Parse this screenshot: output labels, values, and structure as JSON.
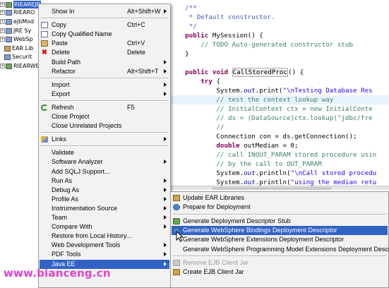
{
  "tree": {
    "items": [
      {
        "label": "RIEAREJB",
        "selected": true,
        "expander": "+"
      },
      {
        "label": "RIEARO",
        "expander": "+"
      },
      {
        "label": "ejbMod",
        "expander": "+"
      },
      {
        "label": "JRE Sy",
        "expander": "+"
      },
      {
        "label": "WebSp",
        "expander": "+"
      },
      {
        "label": "EAR Lib",
        "expander": ""
      },
      {
        "label": "Securit",
        "expander": ""
      },
      {
        "label": "RIEARWEB",
        "expander": "+"
      }
    ]
  },
  "editor": {
    "lines": [
      [
        {
          "t": "    /**",
          "c": "doc"
        }
      ],
      [
        {
          "t": "     * Default constructor.",
          "c": "doc"
        }
      ],
      [
        {
          "t": "     */",
          "c": "doc"
        }
      ],
      [
        {
          "t": "    ",
          "c": ""
        },
        {
          "t": "public",
          "c": "kw"
        },
        {
          "t": " MySession() {",
          "c": ""
        }
      ],
      [
        {
          "t": "        // TODO Auto-generated constructor stub",
          "c": "comment"
        }
      ],
      [
        {
          "t": "    }",
          "c": ""
        }
      ],
      [
        {
          "t": "",
          "c": ""
        }
      ],
      [
        {
          "t": "    ",
          "c": ""
        },
        {
          "t": "public void",
          "c": "kw"
        },
        {
          "t": " ",
          "c": ""
        },
        {
          "t": "CallStoredProc",
          "c": "boxed"
        },
        {
          "t": "() {",
          "c": ""
        }
      ],
      [
        {
          "t": "        ",
          "c": ""
        },
        {
          "t": "try",
          "c": "kw"
        },
        {
          "t": " {",
          "c": ""
        }
      ],
      [
        {
          "t": "            System.",
          "c": ""
        },
        {
          "t": "out",
          "c": "field"
        },
        {
          "t": ".print(",
          "c": ""
        },
        {
          "t": "\"\\nTesting Database Res",
          "c": "str"
        }
      ],
      [
        {
          "t": "            // test the context lookup way",
          "c": "comment"
        }
      ],
      [
        {
          "t": "            // InitialContext ctx = new InitialConte",
          "c": "comment"
        }
      ],
      [
        {
          "t": "            // ds = (DataSource)ctx.lookup(\"jdbc/fre",
          "c": "comment"
        }
      ],
      [
        {
          "t": "            //",
          "c": "comment"
        }
      ],
      [
        {
          "t": "            Connection con = ds.getConnection();",
          "c": ""
        }
      ],
      [
        {
          "t": "            ",
          "c": ""
        },
        {
          "t": "double",
          "c": "kw"
        },
        {
          "t": " outMedian = 0;",
          "c": ""
        }
      ],
      [
        {
          "t": "            // call INOUT_PARAM stored procedure usin",
          "c": "comment"
        }
      ],
      [
        {
          "t": "            // by the call to OUT_PARAM",
          "c": "comment"
        }
      ],
      [
        {
          "t": "            System.",
          "c": ""
        },
        {
          "t": "out",
          "c": "field"
        },
        {
          "t": ".println(",
          "c": ""
        },
        {
          "t": "\"\\nCall stored procedu",
          "c": "str"
        }
      ],
      [
        {
          "t": "            System.",
          "c": ""
        },
        {
          "t": "out",
          "c": "field"
        },
        {
          "t": ".println(",
          "c": ""
        },
        {
          "t": "\"using the median retu",
          "c": "str"
        }
      ]
    ]
  },
  "context_menu": {
    "items": [
      {
        "type": "item",
        "name": "menu-show-in",
        "label": "Show In",
        "accel": "Alt+Shift+W",
        "submenu": true
      },
      {
        "type": "sep"
      },
      {
        "type": "item",
        "name": "menu-copy",
        "label": "Copy",
        "accel": "Ctrl+C",
        "icon": "copy-icon"
      },
      {
        "type": "item",
        "name": "menu-copy-qualified-name",
        "label": "Copy Qualified Name",
        "icon": "copy-qualified-icon"
      },
      {
        "type": "item",
        "name": "menu-paste",
        "label": "Paste",
        "accel": "Ctrl+V",
        "icon": "paste-icon"
      },
      {
        "type": "item",
        "name": "menu-delete",
        "label": "Delete",
        "accel": "Delete",
        "icon": "delete-icon"
      },
      {
        "type": "item",
        "name": "menu-build-path",
        "label": "Build Path",
        "submenu": true
      },
      {
        "type": "item",
        "name": "menu-refactor",
        "label": "Refactor",
        "accel": "Alt+Shift+T",
        "submenu": true
      },
      {
        "type": "sep"
      },
      {
        "type": "item",
        "name": "menu-import",
        "label": "Import",
        "submenu": true
      },
      {
        "type": "item",
        "name": "menu-export",
        "label": "Export",
        "submenu": true
      },
      {
        "type": "sep"
      },
      {
        "type": "item",
        "name": "menu-refresh",
        "label": "Refresh",
        "accel": "F5",
        "icon": "refresh-icon"
      },
      {
        "type": "item",
        "name": "menu-close-project",
        "label": "Close Project"
      },
      {
        "type": "item",
        "name": "menu-close-unrelated-projects",
        "label": "Close Unrelated Projects"
      },
      {
        "type": "sep"
      },
      {
        "type": "item",
        "name": "menu-links",
        "label": "Links",
        "submenu": true,
        "icon": "links-icon"
      },
      {
        "type": "sep"
      },
      {
        "type": "item",
        "name": "menu-validate",
        "label": "Validate"
      },
      {
        "type": "item",
        "name": "menu-software-analyzer",
        "label": "Software Analyzer",
        "submenu": true
      },
      {
        "type": "item",
        "name": "menu-add-sqlj-support",
        "label": "Add SQLJ Support..."
      },
      {
        "type": "item",
        "name": "menu-run-as",
        "label": "Run As",
        "submenu": true
      },
      {
        "type": "item",
        "name": "menu-debug-as",
        "label": "Debug As",
        "submenu": true
      },
      {
        "type": "item",
        "name": "menu-profile-as",
        "label": "Profile As",
        "submenu": true
      },
      {
        "type": "item",
        "name": "menu-instrumentation-source",
        "label": "Instrumentation Source",
        "submenu": true
      },
      {
        "type": "item",
        "name": "menu-team",
        "label": "Team",
        "submenu": true
      },
      {
        "type": "item",
        "name": "menu-compare-with",
        "label": "Compare With",
        "submenu": true
      },
      {
        "type": "item",
        "name": "menu-restore-from-local-history",
        "label": "Restore from Local History..."
      },
      {
        "type": "item",
        "name": "menu-web-development-tools",
        "label": "Web Development Tools",
        "submenu": true
      },
      {
        "type": "item",
        "name": "menu-pdf-tools",
        "label": "PDF Tools",
        "submenu": true
      },
      {
        "type": "item",
        "name": "menu-java-ee",
        "label": "Java EE",
        "submenu": true,
        "selected": true
      }
    ]
  },
  "submenu": {
    "items": [
      {
        "type": "item",
        "name": "submenu-update-ear-libraries",
        "label": "Update EAR Libraries",
        "icon": "jar-icon"
      },
      {
        "type": "item",
        "name": "submenu-prepare-for-deployment",
        "label": "Prepare for Deployment",
        "icon": "deploy-icon"
      },
      {
        "type": "sep"
      },
      {
        "type": "item",
        "name": "submenu-generate-deployment-descriptor-stub",
        "label": "Generate Deployment Descriptor Stub",
        "icon": "descriptor-icon"
      },
      {
        "type": "item",
        "name": "submenu-generate-websphere-bindings",
        "label": "Generate WebSphere Bindings Deployment Descriptor",
        "icon": "websphere-icon",
        "selected": true
      },
      {
        "type": "item",
        "name": "submenu-generate-websphere-extensions",
        "label": "Generate WebSphere Extensions Deployment Descriptor"
      },
      {
        "type": "item",
        "name": "submenu-generate-websphere-programming-model",
        "label": "Generate WebSphere Programming Model Extensions Deployment Descriptor"
      },
      {
        "type": "sep"
      },
      {
        "type": "item",
        "name": "submenu-remove-ejb-client-jar",
        "label": "Remove EJB Client Jar",
        "icon": "remove-jar-icon",
        "disabled": true
      },
      {
        "type": "item",
        "name": "submenu-create-ejb-client-jar",
        "label": "Create EJB Client Jar",
        "icon": "create-jar-icon"
      }
    ]
  },
  "watermark": {
    "text": "www.bianceng.cn"
  },
  "colors": {
    "selection": "#3163c5",
    "menu_bg": "#f2f2f2",
    "comment": "#3f7f5f",
    "keyword": "#7f0055",
    "string": "#2a00ff"
  }
}
